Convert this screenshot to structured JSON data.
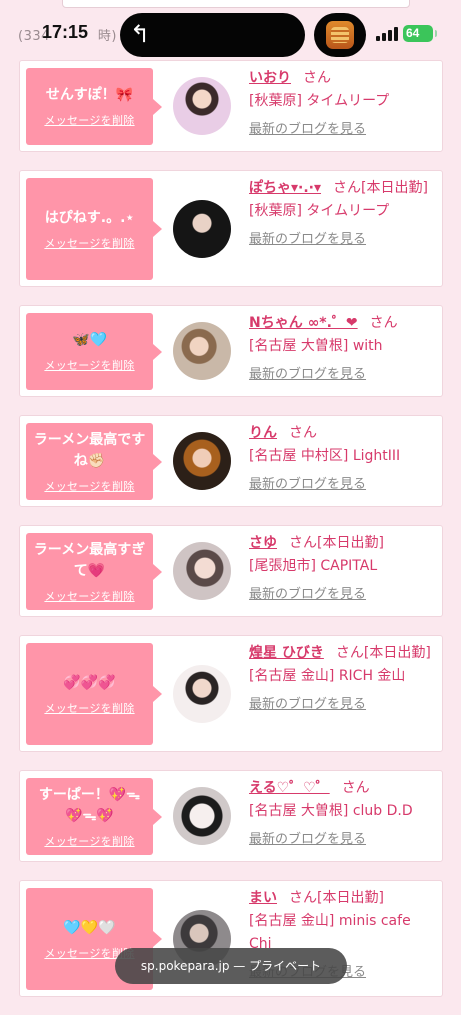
{
  "status_bar": {
    "time": "17:15",
    "battery": "64",
    "underlay_text": "(334",
    "underlay_suffix": "時)"
  },
  "messages": [
    {
      "message": "せんすぽ！🎀",
      "delete_label": "メッセージを削除",
      "name": "いおり",
      "san": "さん",
      "shop": "[秋葉原] タイムリープ",
      "blog_label": "最新のブログを見る"
    },
    {
      "message": "はぴねす.。.⋆",
      "delete_label": "メッセージを削除",
      "name": "ぽちゃ▾·.·▾",
      "san": "さん[本日出勤]",
      "shop": "[秋葉原] タイムリープ",
      "blog_label": "最新のブログを見る"
    },
    {
      "message": "🦋🩵",
      "delete_label": "メッセージを削除",
      "name": "Nちゃん ∞*.゜❤",
      "san": "さん",
      "shop": "[名古屋 大曽根] with",
      "blog_label": "最新のブログを見る"
    },
    {
      "message": "ラーメン最高ですね✊🏻",
      "delete_label": "メッセージを削除",
      "name": "りん",
      "san": "さん",
      "shop": "[名古屋 中村区] LightIII",
      "blog_label": "最新のブログを見る"
    },
    {
      "message": "ラーメン最高すぎて💗",
      "delete_label": "メッセージを削除",
      "name": "さゆ",
      "san": "さん[本日出勤]",
      "shop": "[尾張旭市] CAPITAL",
      "blog_label": "最新のブログを見る"
    },
    {
      "message": "💞💞💞",
      "delete_label": "メッセージを削除",
      "name": "煌星 ひびき",
      "san": "さん[本日出勤]",
      "shop": "[名古屋 金山] RICH 金山",
      "blog_label": "最新のブログを見る"
    },
    {
      "message": "すーぱー！💖ᯓ 💖ᯓ💖",
      "delete_label": "メッセージを削除",
      "name": "える♡゜♡゜",
      "san": "さん",
      "shop": "[名古屋 大曽根] club D.D",
      "blog_label": "最新のブログを見る"
    },
    {
      "message": "🩵💛🤍",
      "delete_label": "メッセージを削除",
      "name": "まい",
      "san": "さん[本日出勤]",
      "shop": "[名古屋 金山] minis cafe Chi",
      "blog_label": "最新のブログを見る"
    }
  ],
  "url_bar": {
    "text": "sp.pokepara.jp — プライベート"
  },
  "colors": {
    "accent": "#ff95a9",
    "name_pink": "#d73a6b",
    "background": "#fbe8ee"
  }
}
